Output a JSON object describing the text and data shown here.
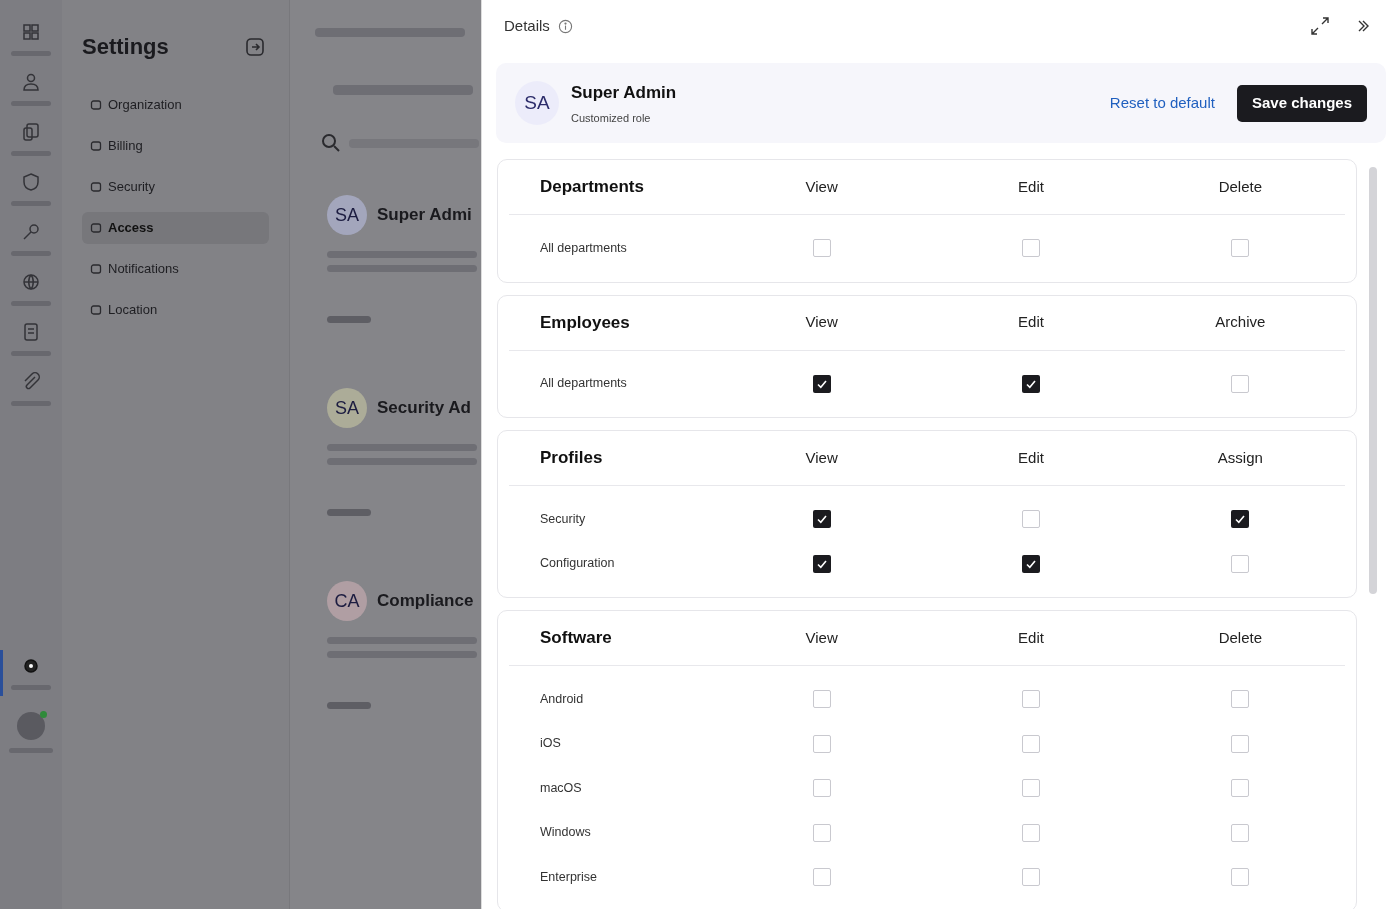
{
  "background": {
    "rail": [
      {
        "kind": "grid",
        "selected": false
      },
      {
        "kind": "person",
        "selected": false
      },
      {
        "kind": "devices",
        "selected": false
      },
      {
        "kind": "shield",
        "selected": false
      },
      {
        "kind": "key",
        "selected": false
      },
      {
        "kind": "globe",
        "selected": false
      },
      {
        "kind": "list",
        "selected": false
      },
      {
        "kind": "clip",
        "selected": false
      },
      {
        "kind": "gear",
        "selected": true
      }
    ],
    "sidebar": {
      "title": "Settings",
      "items": [
        {
          "label": "Organization",
          "selected": false
        },
        {
          "label": "Billing",
          "selected": false
        },
        {
          "label": "Security",
          "selected": false
        },
        {
          "label": "Access",
          "selected": true
        },
        {
          "label": "Notifications",
          "selected": false
        },
        {
          "label": "Location",
          "selected": false
        }
      ]
    },
    "roles": [
      {
        "initials": "SA",
        "name": "Super Admi",
        "color": "#a3a6bc"
      },
      {
        "initials": "SA",
        "name": "Security Ad",
        "color": "#acac98"
      },
      {
        "initials": "CA",
        "name": "Compliance",
        "color": "#b09ea3"
      }
    ]
  },
  "panel": {
    "title": "Details",
    "role": {
      "initials": "SA",
      "name": "Super Admin",
      "subtitle": "Customized role"
    },
    "reset_link": "Reset to default",
    "save_button": "Save changes",
    "sections": [
      {
        "title": "Departments",
        "columns": [
          "View",
          "Edit",
          "Delete"
        ],
        "rows": [
          {
            "label": "All departments",
            "checked": [
              false,
              false,
              false
            ]
          }
        ]
      },
      {
        "title": "Employees",
        "columns": [
          "View",
          "Edit",
          "Archive"
        ],
        "rows": [
          {
            "label": "All departments",
            "checked": [
              true,
              true,
              false
            ]
          }
        ]
      },
      {
        "title": "Profiles",
        "columns": [
          "View",
          "Edit",
          "Assign"
        ],
        "rows": [
          {
            "label": "Security",
            "checked": [
              true,
              false,
              true
            ]
          },
          {
            "label": "Configuration",
            "checked": [
              true,
              true,
              false
            ]
          }
        ]
      },
      {
        "title": "Software",
        "columns": [
          "View",
          "Edit",
          "Delete"
        ],
        "rows": [
          {
            "label": "Android",
            "checked": [
              false,
              false,
              false
            ]
          },
          {
            "label": "iOS",
            "checked": [
              false,
              false,
              false
            ]
          },
          {
            "label": "macOS",
            "checked": [
              false,
              false,
              false
            ]
          },
          {
            "label": "Windows",
            "checked": [
              false,
              false,
              false
            ]
          },
          {
            "label": "Enterprise",
            "checked": [
              false,
              false,
              false
            ]
          }
        ]
      }
    ]
  }
}
